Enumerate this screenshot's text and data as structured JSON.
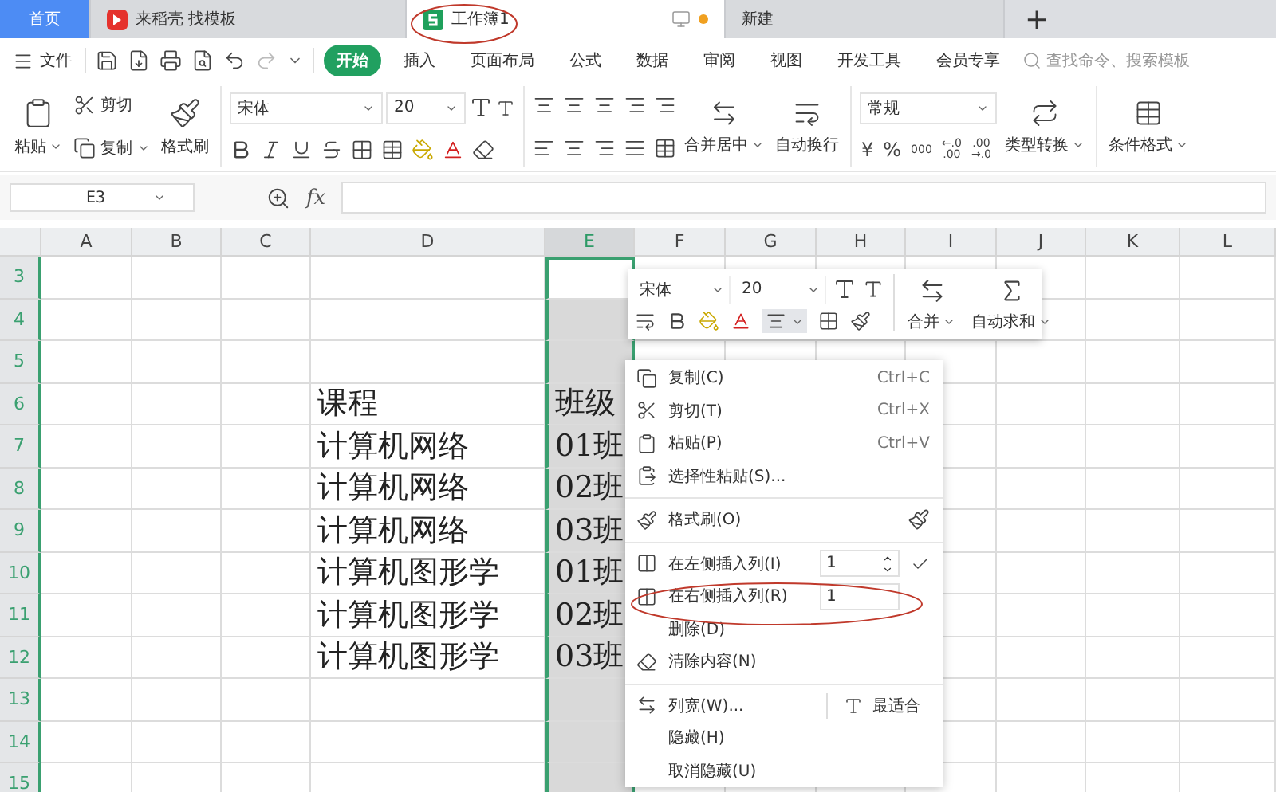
{
  "tabs": [
    {
      "label": "首页",
      "kind": "home",
      "selected": false
    },
    {
      "label": "来稻壳 找模板",
      "kind": "docer",
      "selected": false
    },
    {
      "label": "工作簿1",
      "kind": "sheet",
      "selected": true
    },
    {
      "label": "新建",
      "kind": "new",
      "selected": false
    }
  ],
  "new_tab_button": "+",
  "menu_bar": {
    "file": "文件",
    "tabs": [
      {
        "label": "开始",
        "selected": true
      },
      {
        "label": "插入",
        "selected": false
      },
      {
        "label": "页面布局",
        "selected": false
      },
      {
        "label": "公式",
        "selected": false
      },
      {
        "label": "数据",
        "selected": false
      },
      {
        "label": "审阅",
        "selected": false
      },
      {
        "label": "视图",
        "selected": false
      },
      {
        "label": "开发工具",
        "selected": false
      },
      {
        "label": "会员专享",
        "selected": false
      }
    ],
    "search": {
      "placeholder": "查找命令、搜索模板"
    }
  },
  "ribbon": {
    "paste": "粘贴",
    "cut": "剪切",
    "copy": "复制",
    "format_painter": "格式刷",
    "font": "宋体",
    "size": "20",
    "merge": "合并居中",
    "wrap": "自动换行",
    "number_format": "常规",
    "number_buttons": [
      "¥",
      "%",
      "000",
      "←.0\n.00",
      ".00\n→.0"
    ],
    "convert": "类型转换",
    "conditional": "条件格式"
  },
  "formula_bar": {
    "name_box": "E3",
    "fx_label": "fx"
  },
  "sheet": {
    "columns": [
      {
        "label": "A",
        "selected": false
      },
      {
        "label": "B",
        "selected": false
      },
      {
        "label": "C",
        "selected": false
      },
      {
        "label": "D",
        "selected": false
      },
      {
        "label": "E",
        "selected": true
      },
      {
        "label": "F",
        "selected": false
      },
      {
        "label": "G",
        "selected": false
      },
      {
        "label": "H",
        "selected": false
      },
      {
        "label": "I",
        "selected": false
      },
      {
        "label": "J",
        "selected": false
      },
      {
        "label": "K",
        "selected": false
      },
      {
        "label": "L",
        "selected": false
      }
    ],
    "rows": [
      {
        "number": "3",
        "active": true
      },
      {
        "number": "4",
        "active": false
      },
      {
        "number": "5",
        "active": false
      },
      {
        "number": "6",
        "active": false,
        "cells": {
          "D": "课程",
          "E": "班级"
        }
      },
      {
        "number": "7",
        "active": false,
        "cells": {
          "D": "计算机网络",
          "E": "01班"
        }
      },
      {
        "number": "8",
        "active": false,
        "cells": {
          "D": "计算机网络",
          "E": "02班"
        }
      },
      {
        "number": "9",
        "active": false,
        "cells": {
          "D": "计算机网络",
          "E": "03班"
        }
      },
      {
        "number": "10",
        "active": false,
        "cells": {
          "D": "计算机图形学",
          "E": "01班"
        }
      },
      {
        "number": "11",
        "active": false,
        "cells": {
          "D": "计算机图形学",
          "E": "02班"
        }
      },
      {
        "number": "12",
        "active": false,
        "cells": {
          "D": "计算机图形学",
          "E": "03班"
        }
      },
      {
        "number": "13",
        "active": false
      },
      {
        "number": "14",
        "active": false
      },
      {
        "number": "15",
        "active": false
      }
    ]
  },
  "mini_toolbar": {
    "font": "宋体",
    "size": "20",
    "merge": "合并",
    "autosum": "自动求和"
  },
  "context_menu": [
    {
      "kind": "item",
      "label": "复制(C)",
      "shortcut": "Ctrl+C"
    },
    {
      "kind": "item",
      "label": "剪切(T)",
      "shortcut": "Ctrl+X"
    },
    {
      "kind": "item",
      "label": "粘贴(P)",
      "shortcut": "Ctrl+V"
    },
    {
      "kind": "item",
      "label": "选择性粘贴(S)..."
    },
    {
      "kind": "divider"
    },
    {
      "kind": "painter",
      "label": "格式刷(O)"
    },
    {
      "kind": "divider"
    },
    {
      "kind": "insert",
      "label": "在左侧插入列(I)",
      "value": "1",
      "confirm": true
    },
    {
      "kind": "insert",
      "label": "在右侧插入列(R)",
      "value": "1",
      "confirm": false
    },
    {
      "kind": "item",
      "label": "删除(D)"
    },
    {
      "kind": "item",
      "label": "清除内容(N)"
    },
    {
      "kind": "divider"
    },
    {
      "kind": "split",
      "label": "列宽(W)...",
      "side_label": "最适合"
    },
    {
      "kind": "item",
      "label": "隐藏(H)"
    },
    {
      "kind": "item",
      "label": "取消隐藏(U)"
    }
  ]
}
